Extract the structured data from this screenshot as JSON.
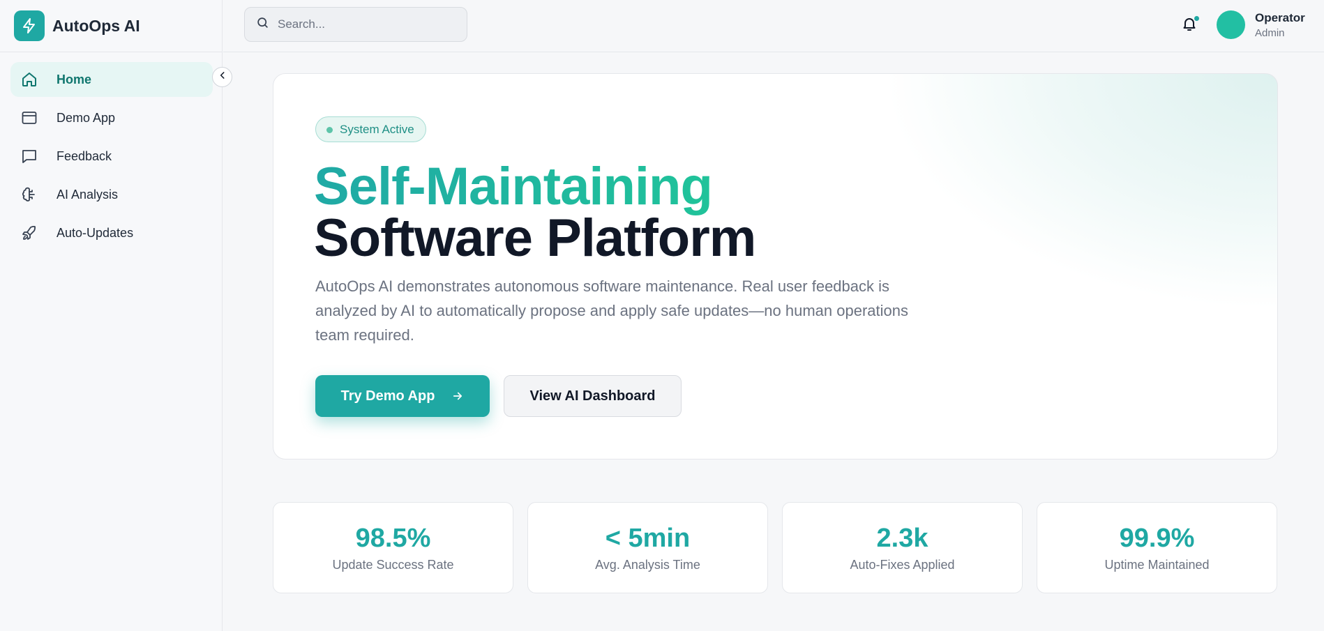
{
  "brand": {
    "name": "AutoOps AI",
    "accent": "#1fa8a3"
  },
  "sidebar": {
    "items": [
      {
        "label": "Home",
        "icon": "home-icon",
        "active": true
      },
      {
        "label": "Demo App",
        "icon": "browser-window-icon",
        "active": false
      },
      {
        "label": "Feedback",
        "icon": "message-square-icon",
        "active": false
      },
      {
        "label": "AI Analysis",
        "icon": "brain-icon",
        "active": false
      },
      {
        "label": "Auto-Updates",
        "icon": "rocket-icon",
        "active": false
      }
    ],
    "collapse_icon": "chevron-left-icon"
  },
  "header": {
    "search": {
      "placeholder": "Search...",
      "value": ""
    },
    "notification_icon": "bell-icon",
    "user": {
      "name": "Operator",
      "role": "Admin"
    }
  },
  "hero": {
    "badge": "System Active",
    "title_line1": "Self-Maintaining",
    "title_line2": "Software Platform",
    "description": "AutoOps AI demonstrates autonomous software maintenance. Real user feedback is analyzed by AI to automatically propose and apply safe updates—no human operations team required.",
    "primary_button": "Try Demo App",
    "secondary_button": "View AI Dashboard"
  },
  "stats": [
    {
      "value": "98.5%",
      "label": "Update Success Rate"
    },
    {
      "value": "< 5min",
      "label": "Avg. Analysis Time"
    },
    {
      "value": "2.3k",
      "label": "Auto-Fixes Applied"
    },
    {
      "value": "99.9%",
      "label": "Uptime Maintained"
    }
  ]
}
